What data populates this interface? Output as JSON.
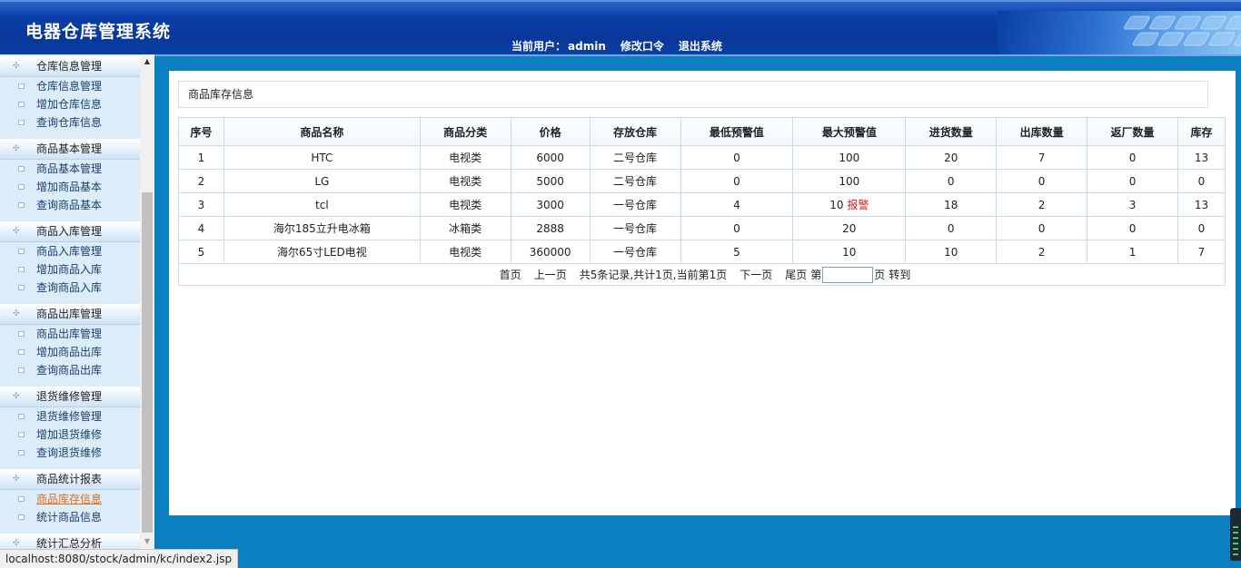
{
  "header": {
    "app_title": "电器仓库管理系统",
    "current_user_label": "当前用户：",
    "current_user": "admin",
    "change_password": "修改口令",
    "logout": "退出系统"
  },
  "sidebar": {
    "groups": [
      {
        "title": "仓库信息管理",
        "items": [
          {
            "label": "仓库信息管理"
          },
          {
            "label": "增加仓库信息"
          },
          {
            "label": "查询仓库信息"
          }
        ]
      },
      {
        "title": "商品基本管理",
        "items": [
          {
            "label": "商品基本管理"
          },
          {
            "label": "增加商品基本"
          },
          {
            "label": "查询商品基本"
          }
        ]
      },
      {
        "title": "商品入库管理",
        "items": [
          {
            "label": "商品入库管理"
          },
          {
            "label": "增加商品入库"
          },
          {
            "label": "查询商品入库"
          }
        ]
      },
      {
        "title": "商品出库管理",
        "items": [
          {
            "label": "商品出库管理"
          },
          {
            "label": "增加商品出库"
          },
          {
            "label": "查询商品出库"
          }
        ]
      },
      {
        "title": "退货维修管理",
        "items": [
          {
            "label": "退货维修管理"
          },
          {
            "label": "增加退货维修"
          },
          {
            "label": "查询退货维修"
          }
        ]
      },
      {
        "title": "商品统计报表",
        "items": [
          {
            "label": "商品库存信息",
            "active": true
          },
          {
            "label": "统计商品信息"
          }
        ]
      },
      {
        "title": "统计汇总分析",
        "items": []
      }
    ]
  },
  "main": {
    "section_title": "商品库存信息",
    "table": {
      "headers": [
        "序号",
        "商品名称",
        "商品分类",
        "价格",
        "存放仓库",
        "最低预警值",
        "最大预警值",
        "进货数量",
        "出库数量",
        "返厂数量",
        "库存"
      ],
      "rows": [
        [
          "1",
          "HTC",
          "电视类",
          "6000",
          "二号仓库",
          "0",
          "100",
          "20",
          "7",
          "0",
          "13"
        ],
        [
          "2",
          "LG",
          "电视类",
          "5000",
          "二号仓库",
          "0",
          "100",
          "0",
          "0",
          "0",
          "0"
        ],
        [
          "3",
          "tcl",
          "电视类",
          "3000",
          "一号仓库",
          "4",
          "10",
          "18",
          "2",
          "3",
          "13"
        ],
        [
          "4",
          "海尔185立升电冰箱",
          "冰箱类",
          "2888",
          "一号仓库",
          "0",
          "20",
          "0",
          "0",
          "0",
          "0"
        ],
        [
          "5",
          "海尔65寸LED电视",
          "电视类",
          "360000",
          "一号仓库",
          "5",
          "10",
          "10",
          "2",
          "1",
          "7"
        ]
      ],
      "alert_text": "报警"
    },
    "pager": {
      "first": "首页",
      "prev": "上一页",
      "summary": "共5条记录,共计1页,当前第1页",
      "next": "下一页",
      "last": "尾页",
      "page_prefix": "第",
      "page_suffix": "页",
      "goto": "转到"
    }
  },
  "status_bar": {
    "url": "localhost:8080/stock/admin/kc/index2.jsp"
  }
}
